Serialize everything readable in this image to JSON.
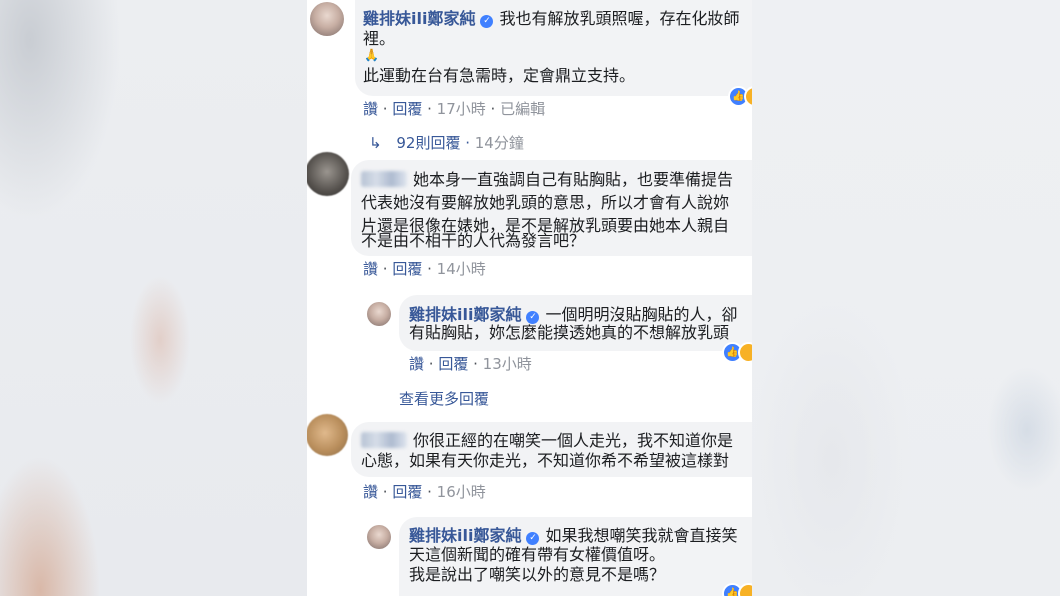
{
  "comments": [
    {
      "author": "雞排妹ili鄭家純",
      "lines": [
        "我也有解放乳頭照喔，存在化妝師",
        "裡。",
        "此運動在台有急需時，定會鼎立支持。"
      ],
      "emoji": "🙏",
      "actions": {
        "like": "讚",
        "reply": "回覆",
        "time": "17小時",
        "edited": "已編輯"
      },
      "replies_link": {
        "label": "92則回覆",
        "time": "14分鐘"
      }
    },
    {
      "lines": [
        "她本身一直強調自己有貼胸貼，也要準備提告",
        "代表她沒有要解放她乳頭的意思，所以才會有人說妳",
        "片還是很像在婊她，是不是解放乳頭要由她本人親自",
        "不是由不相干的人代為發言吧？"
      ],
      "actions": {
        "like": "讚",
        "reply": "回覆",
        "time": "14小時"
      },
      "reply": {
        "author": "雞排妹ili鄭家純",
        "lines": [
          "一個明明沒貼胸貼的人，卻",
          "有貼胸貼，妳怎麼能摸透她真的不想解放乳頭"
        ],
        "actions": {
          "like": "讚",
          "reply": "回覆",
          "time": "13小時"
        }
      },
      "more_replies": "查看更多回覆"
    },
    {
      "lines": [
        "你很正經的在嘲笑一個人走光，我不知道你是",
        "心態，如果有天你走光，不知道你希不希望被這樣對"
      ],
      "actions": {
        "like": "讚",
        "reply": "回覆",
        "time": "16小時"
      },
      "reply": {
        "author": "雞排妹ili鄭家純",
        "lines": [
          "如果我想嘲笑我就會直接笑",
          "天這個新聞的確有帶有女權價值呀。",
          "我是說出了嘲笑以外的意見不是嗎？"
        ]
      }
    }
  ],
  "icons": {
    "verified": "✓",
    "like": "👍",
    "reply_arrow": "↳"
  },
  "colors": {
    "link": "#385898",
    "bubble": "#f2f3f5",
    "meta": "#90949c"
  }
}
